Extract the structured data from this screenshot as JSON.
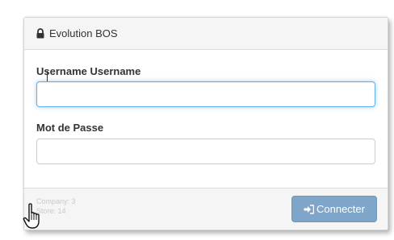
{
  "panel": {
    "title": "Evolution BOS",
    "title_icon": "lock-icon"
  },
  "form": {
    "username_label": "Username Username",
    "username_value": "",
    "password_label": "Mot de Passe",
    "password_value": ""
  },
  "footer": {
    "company": "Company: 3",
    "store": "Store: 14",
    "connect_label": "Connecter",
    "connect_icon": "sign-in-icon"
  },
  "colors": {
    "button": "#7fa6c8",
    "focus_border": "#66afe9",
    "heading_bg": "#f5f5f5"
  },
  "cursor": "hand-pointer-icon"
}
